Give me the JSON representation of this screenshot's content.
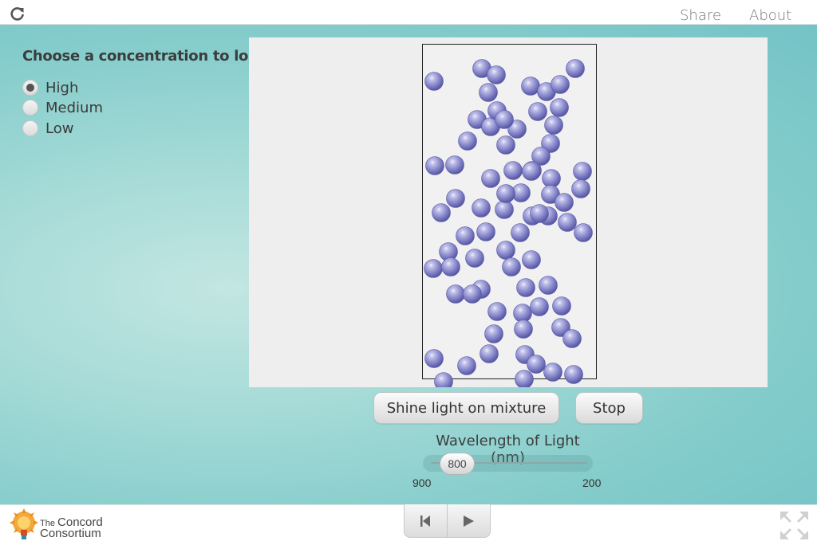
{
  "header": {
    "share_label": "Share",
    "about_label": "About",
    "reload_icon": "reload-icon"
  },
  "sidebar": {
    "title": "Choose a concentration to load",
    "options": [
      {
        "label": "High",
        "checked": true
      },
      {
        "label": "Medium",
        "checked": false
      },
      {
        "label": "Low",
        "checked": false
      }
    ]
  },
  "simulation": {
    "molecule_count": 74,
    "molecule_color": "#8c8ccc",
    "background_color": "#eeeeee",
    "container_color": "#f1f1f1"
  },
  "controls": {
    "shine_label": "Shine light on mixture",
    "stop_label": "Stop",
    "wavelength_label": "Wavelength of Light (nm)",
    "slider_value": "800",
    "slider_min_label": "900",
    "slider_max_label": "200"
  },
  "footer": {
    "logo_line1_small": "The",
    "logo_line1": "Concord",
    "logo_line2": "Consortium",
    "reset_icon": "reset-icon",
    "play_icon": "play-icon",
    "fullscreen_icon": "fullscreen-icon"
  },
  "colors": {
    "teal_background": "#86cdcc",
    "accent_orange": "#f0a020"
  }
}
